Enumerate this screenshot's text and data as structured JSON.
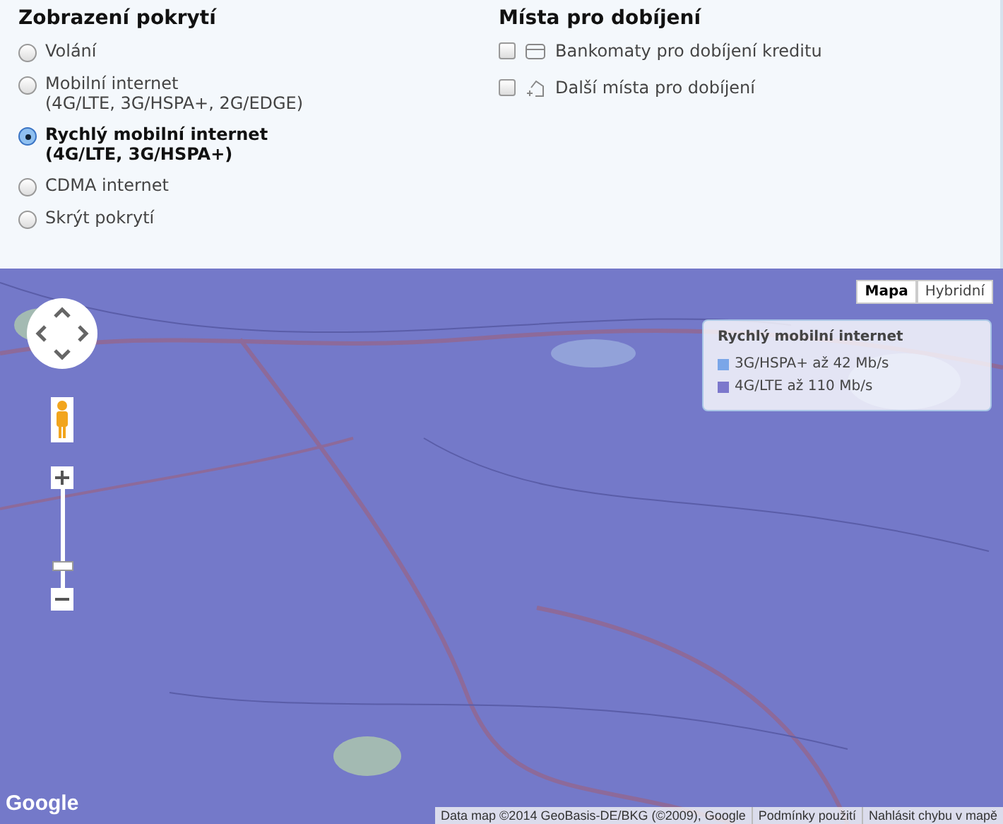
{
  "coverage": {
    "title": "Zobrazení pokrytí",
    "options": [
      {
        "lines": [
          "Volání"
        ],
        "selected": false
      },
      {
        "lines": [
          "Mobilní internet",
          "(4G/LTE, 3G/HSPA+, 2G/EDGE)"
        ],
        "selected": false
      },
      {
        "lines": [
          "Rychlý mobilní internet",
          "(4G/LTE, 3G/HSPA+)"
        ],
        "selected": true
      },
      {
        "lines": [
          "CDMA internet"
        ],
        "selected": false
      },
      {
        "lines": [
          "Skrýt pokrytí"
        ],
        "selected": false
      }
    ]
  },
  "topup": {
    "title": "Místa pro dobíjení",
    "options": [
      {
        "label": "Bankomaty pro dobíjení kreditu",
        "kind": "atm",
        "checked": false
      },
      {
        "label": "Další místa pro dobíjení",
        "kind": "other",
        "checked": false
      }
    ]
  },
  "map": {
    "map_types": [
      {
        "label": "Mapa",
        "selected": true
      },
      {
        "label": "Hybridní",
        "selected": false
      }
    ],
    "legend": {
      "title": "Rychlý mobilní internet",
      "items": [
        {
          "label": "3G/HSPA+ až 42 Mb/s",
          "color": "#7aa6e8"
        },
        {
          "label": "4G/LTE až 110 Mb/s",
          "color": "#7c78cc"
        }
      ]
    },
    "zoom": {
      "level": 0.17
    },
    "logo": "Google",
    "attribution": [
      "Data map ©2014 GeoBasis-DE/BKG (©2009), Google",
      "Podmínky použití",
      "Nahlásit chybu v mapě"
    ]
  }
}
